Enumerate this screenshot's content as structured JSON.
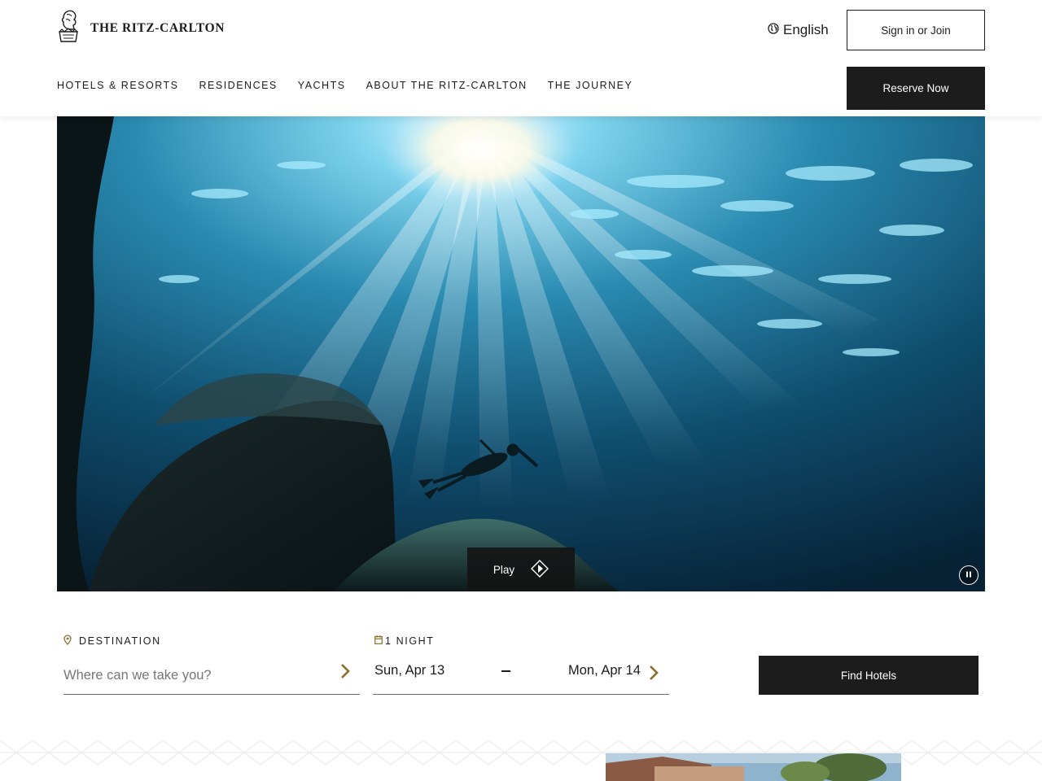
{
  "header": {
    "brand": "THE RITZ-CARLTON",
    "language": "English",
    "signin_label": "Sign in or Join",
    "reserve_label": "Reserve Now",
    "nav": [
      "HOTELS & RESORTS",
      "RESIDENCES",
      "YACHTS",
      "ABOUT THE RITZ-CARLTON",
      "THE JOURNEY"
    ]
  },
  "hero": {
    "play_label": "Play",
    "video_state": "playing"
  },
  "search": {
    "destination_label": "DESTINATION",
    "destination_placeholder": "Where can we take you?",
    "destination_value": "",
    "nights_label": "1 NIGHT",
    "check_in": "Sun, Apr 13",
    "check_out": "Mon, Apr 14",
    "find_label": "Find Hotels"
  },
  "colors": {
    "primary": "#1c1c1c",
    "accent_gold": "#8a6d2b",
    "background": "#ffffff"
  },
  "icons": {
    "logo": "lion-crest-logo-icon",
    "language": "globe-icon",
    "play": "diamond-play-icon",
    "pause": "pause-icon",
    "destination": "map-pin-icon",
    "dates": "calendar-icon",
    "chevron": "chevron-right-icon"
  }
}
